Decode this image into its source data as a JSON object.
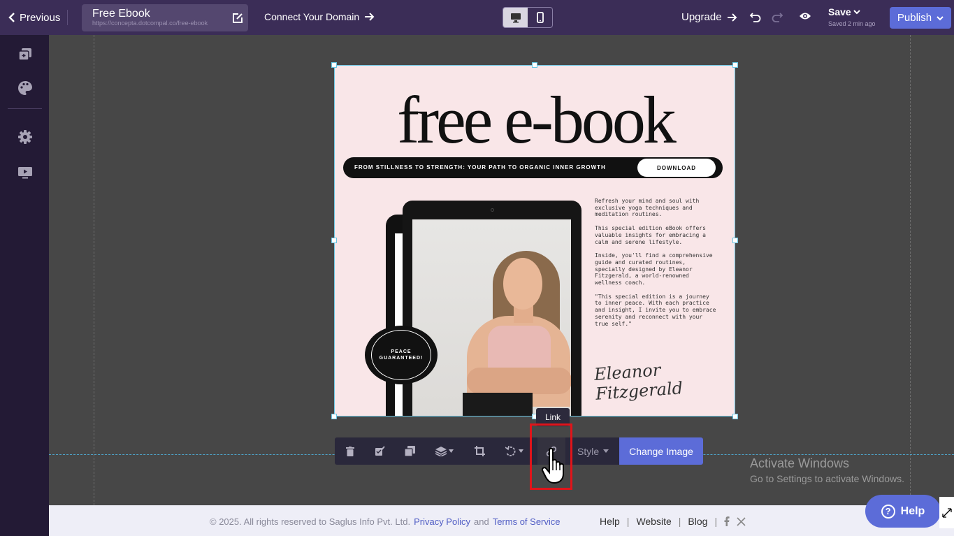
{
  "topbar": {
    "previous_label": "Previous",
    "page_title": "Free Ebook",
    "page_url": "https://concepta.dotcompal.co/free-ebook",
    "connect_domain_label": "Connect Your Domain",
    "upgrade_label": "Upgrade",
    "save_label": "Save",
    "saved_status": "Saved 2 min ago",
    "publish_label": "Publish"
  },
  "sidebar": {
    "items": [
      {
        "icon": "pages-icon"
      },
      {
        "icon": "palette-icon"
      },
      {
        "icon": "gear-icon"
      },
      {
        "icon": "monitor-play-icon"
      }
    ]
  },
  "image_content": {
    "headline": "free e-book",
    "banner_text": "FROM STILLNESS TO STRENGTH: YOUR PATH TO ORGANIC INNER GROWTH",
    "download_label": "DOWNLOAD",
    "badge_line1": "PEACE",
    "badge_line2": "GUARANTEED!",
    "paragraphs": [
      "Refresh your mind and soul with exclusive yoga techniques and meditation routines.",
      " This special edition eBook offers valuable insights for embracing a calm and serene lifestyle.",
      "Inside, you'll find a comprehensive guide and curated routines, specially designed by Eleanor Fitzgerald, a world-renowned wellness coach.",
      "\"This special edition is a journey to inner peace. With each practice and insight, I invite you to embrace serenity and reconnect with your true self.\""
    ],
    "signature": "Eleanor Fitzgerald"
  },
  "toolbar": {
    "tooltip": "Link",
    "style_label": "Style",
    "change_image_label": "Change Image"
  },
  "watermark": {
    "line1": "Activate Windows",
    "line2": "Go to Settings to activate Windows."
  },
  "footer": {
    "copyright": "©  2025. All rights reserved to Saglus Info Pvt. Ltd.",
    "privacy": "Privacy Policy",
    "and": "and",
    "terms": "Terms of Service",
    "help": "Help",
    "website": "Website",
    "blog": "Blog",
    "pipe": "|"
  },
  "help_button": {
    "label": "Help"
  },
  "colors": {
    "topbar": "#3b2d57",
    "sidebar": "#231a35",
    "accent": "#5c6cd8",
    "highlight": "#e0141a"
  }
}
